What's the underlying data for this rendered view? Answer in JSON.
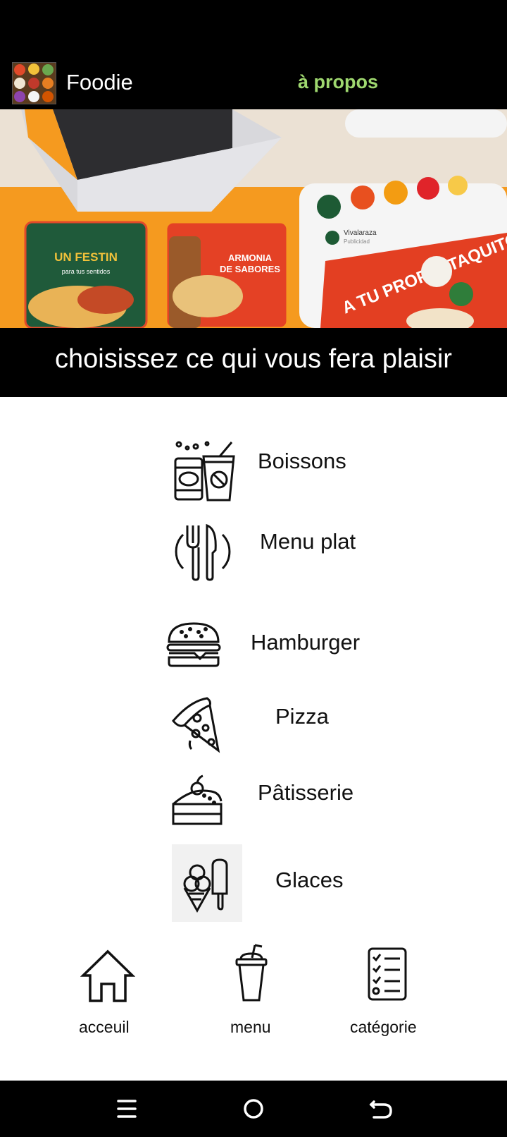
{
  "header": {
    "app_title": "Foodie",
    "about_label": "à propos"
  },
  "banner": {
    "card1_line1": "UN FESTIN",
    "card1_line2": "para tus sentidos",
    "card2_line1": "ARMONIA",
    "card2_line2": "DE SABORES",
    "phone_handle": "Vivalaraza",
    "phone_sub": "Publicidad",
    "phone_text": "A TU PROPIO TAQUITO!"
  },
  "tagline": "choisissez ce qui vous fera plaisir",
  "categories": [
    {
      "label": "Boissons",
      "icon": "drinks-icon"
    },
    {
      "label": "Menu plat",
      "icon": "cutlery-icon"
    },
    {
      "label": "Hamburger",
      "icon": "burger-icon"
    },
    {
      "label": "Pizza",
      "icon": "pizza-icon"
    },
    {
      "label": "Pâtisserie",
      "icon": "cake-icon"
    },
    {
      "label": "Glaces",
      "icon": "ice-cream-icon"
    }
  ],
  "bottom_nav": [
    {
      "label": "acceuil",
      "icon": "home-icon"
    },
    {
      "label": "menu",
      "icon": "cup-icon"
    },
    {
      "label": "catégorie",
      "icon": "checklist-icon"
    }
  ],
  "system_nav": [
    "menu-lines-icon",
    "home-circle-icon",
    "back-icon"
  ],
  "colors": {
    "accent": "#9fd86f",
    "banner_orange": "#f59a1f",
    "dark": "#000000"
  }
}
